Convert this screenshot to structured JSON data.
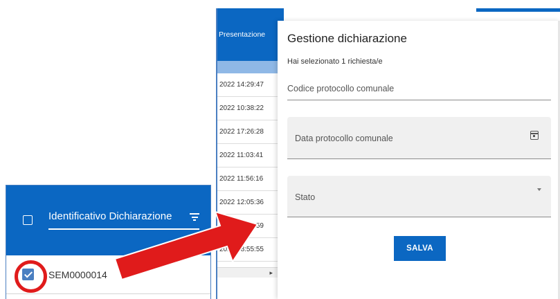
{
  "background_table": {
    "column_header": "Presentazione",
    "rows": [
      "2022 14:29:47",
      "2022 10:38:22",
      "2022 17:26:28",
      "2022 11:03:41",
      "2022 11:56:16",
      "2022 12:05:36",
      "2022 09:47:59",
      "2022 08:55:55"
    ],
    "scroll_arrow": "▸"
  },
  "dialog": {
    "title": "Gestione dichiarazione",
    "subtitle": "Hai selezionato 1 richiesta/e",
    "fields": {
      "codice_placeholder": "Codice protocollo comunale",
      "data_label": "Data protocollo comunale",
      "data_icon": "calendar-icon",
      "stato_label": "Stato",
      "stato_icon": "dropdown-caret-icon"
    },
    "save_label": "SALVA"
  },
  "zoom_panel": {
    "header_label": "Identificativo Dichiarazione",
    "header_icon": "filter-icon",
    "row_value": "SEM0000014",
    "row_checked": true
  },
  "colors": {
    "primary": "#0b67c2",
    "highlight_red": "#e01b1b",
    "checkbox": "#4a7fc1"
  }
}
